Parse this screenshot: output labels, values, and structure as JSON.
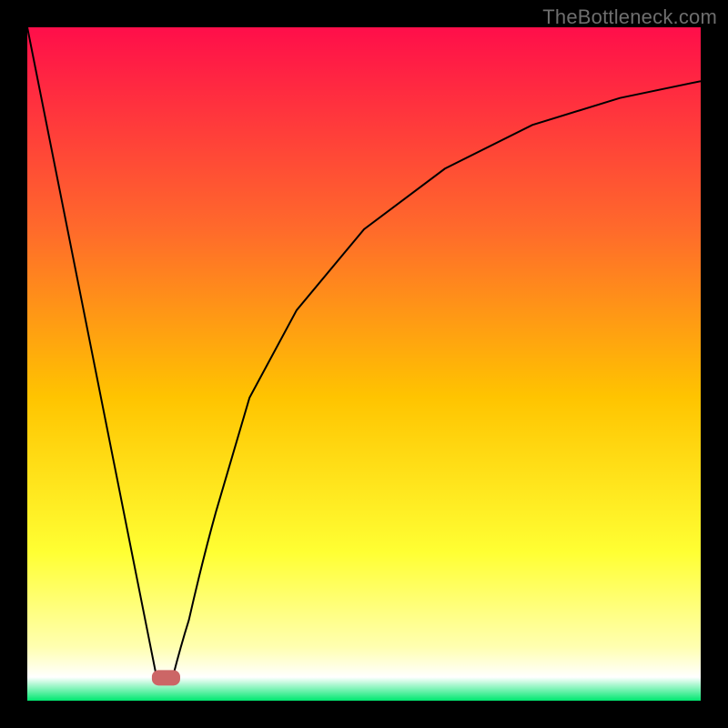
{
  "watermark": "TheBottleneck.com",
  "chart_data": {
    "type": "line",
    "title": "",
    "xlabel": "",
    "ylabel": "",
    "xlim": [
      0,
      100
    ],
    "ylim": [
      0,
      100
    ],
    "grid": false,
    "legend": false,
    "background_gradient": {
      "stops": [
        {
          "offset": 0.0,
          "color": "#ff0e4a"
        },
        {
          "offset": 0.3,
          "color": "#ff6a2b"
        },
        {
          "offset": 0.55,
          "color": "#ffc400"
        },
        {
          "offset": 0.78,
          "color": "#ffff33"
        },
        {
          "offset": 0.92,
          "color": "#ffffb0"
        },
        {
          "offset": 0.965,
          "color": "#ffffff"
        },
        {
          "offset": 1.0,
          "color": "#00e870"
        }
      ]
    },
    "series": [
      {
        "name": "left-branch",
        "x": [
          0,
          19.2
        ],
        "values": [
          100,
          3.5
        ]
      },
      {
        "name": "right-branch",
        "x": [
          21.6,
          24,
          28,
          33,
          40,
          50,
          62,
          75,
          88,
          100
        ],
        "values": [
          3.5,
          12,
          28,
          45,
          58,
          70,
          79,
          85.5,
          89.5,
          92
        ]
      }
    ],
    "marker": {
      "x_center": 20.6,
      "y_center": 3.4,
      "width": 4.2,
      "height": 2.3,
      "rx": 1.0,
      "color": "#cc6666"
    }
  }
}
